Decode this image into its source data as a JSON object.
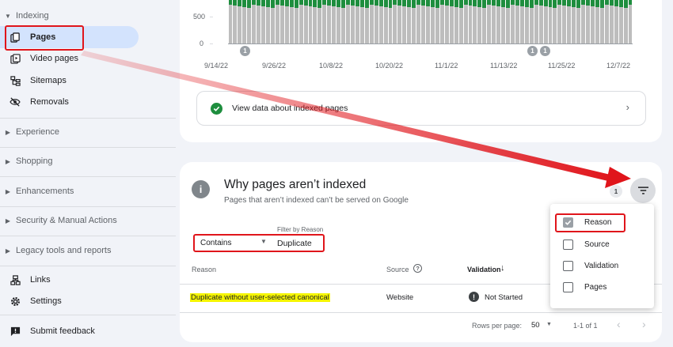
{
  "sidebar": {
    "indexing_header": "Indexing",
    "items": [
      {
        "label": "Pages"
      },
      {
        "label": "Video pages"
      },
      {
        "label": "Sitemaps"
      },
      {
        "label": "Removals"
      }
    ],
    "sections": [
      {
        "label": "Experience"
      },
      {
        "label": "Shopping"
      },
      {
        "label": "Enhancements"
      },
      {
        "label": "Security & Manual Actions"
      },
      {
        "label": "Legacy tools and reports"
      }
    ],
    "bottom_items": [
      {
        "label": "Links"
      },
      {
        "label": "Settings"
      }
    ],
    "feedback": "Submit feedback"
  },
  "chart": {
    "y_ticks": [
      "500",
      "0"
    ],
    "x_ticks": [
      "9/14/22",
      "9/26/22",
      "10/8/22",
      "10/20/22",
      "11/1/22",
      "11/13/22",
      "11/25/22",
      "12/7/22"
    ],
    "markers": [
      "1",
      "1",
      "1"
    ],
    "colors": {
      "indexed": "#1e8e3e",
      "not_indexed": "#bdbdbd"
    }
  },
  "chart_data": {
    "type": "bar",
    "title": "",
    "xlabel": "",
    "ylabel": "",
    "x_tick_labels": [
      "9/14/22",
      "9/26/22",
      "10/8/22",
      "10/20/22",
      "11/1/22",
      "11/13/22",
      "11/25/22",
      "12/7/22"
    ],
    "y_tick_labels": [
      "0",
      "500"
    ],
    "series": [
      {
        "color": "#bdbdbd",
        "note_visible": "grey stacked portion (cropped)"
      },
      {
        "color": "#1e8e3e",
        "note_visible": "green top portion (cropped)"
      }
    ]
  },
  "indexed_link": {
    "label": "View data about indexed pages"
  },
  "why_card": {
    "title": "Why pages aren’t indexed",
    "subtitle": "Pages that aren’t indexed can’t be served on Google",
    "filter_count": "1",
    "filter_label": "Filter by Reason",
    "filter_operator": "Contains",
    "filter_value": "Duplicate",
    "columns": {
      "reason": "Reason",
      "source": "Source",
      "validation": "Validation"
    },
    "rows": [
      {
        "reason": "Duplicate without user-selected canonical",
        "source": "Website",
        "validation": "Not Started"
      }
    ],
    "rows_per_page_label": "Rows per page:",
    "rows_per_page": "50",
    "pagination": "1-1 of 1"
  },
  "filter_menu": {
    "items": [
      {
        "label": "Reason",
        "checked": true
      },
      {
        "label": "Source",
        "checked": false
      },
      {
        "label": "Validation",
        "checked": false
      },
      {
        "label": "Pages",
        "checked": false
      }
    ]
  },
  "colors": {
    "annotation_red": "#e0151b",
    "highlight": "#f5f500",
    "active_nav": "#d3e3fd"
  }
}
